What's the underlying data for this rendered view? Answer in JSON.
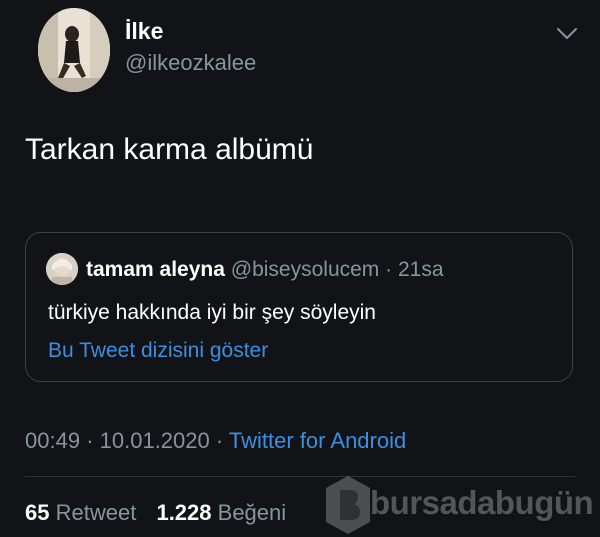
{
  "tweet": {
    "author": {
      "display_name": "İlke",
      "handle": "@ilkeozkalee"
    },
    "text": "Tarkan karma albümü",
    "quoted": {
      "display_name": "tamam aleyna",
      "handle": "@biseysolucem",
      "separator": "·",
      "time": "21sa",
      "text": "türkiye hakkında iyi bir şey söyleyin",
      "thread_link": "Bu Tweet dizisini göster"
    },
    "meta": {
      "time": "00:49",
      "sep1": "·",
      "date": "10.01.2020",
      "sep2": "·",
      "source": "Twitter for Android"
    },
    "stats": {
      "retweets_count": "65",
      "retweets_label": "Retweet",
      "likes_count": "1.228",
      "likes_label": "Beğeni"
    }
  },
  "watermark": {
    "text": "bursadabugün"
  },
  "colors": {
    "background": "#111317",
    "text_primary": "#ffffff",
    "text_secondary": "#8a949e",
    "link": "#3c8fe0",
    "border": "#3b4148"
  },
  "icons": {
    "caret": "chevron-down-icon",
    "watermark_logo": "bursadabugun-logo-icon"
  }
}
